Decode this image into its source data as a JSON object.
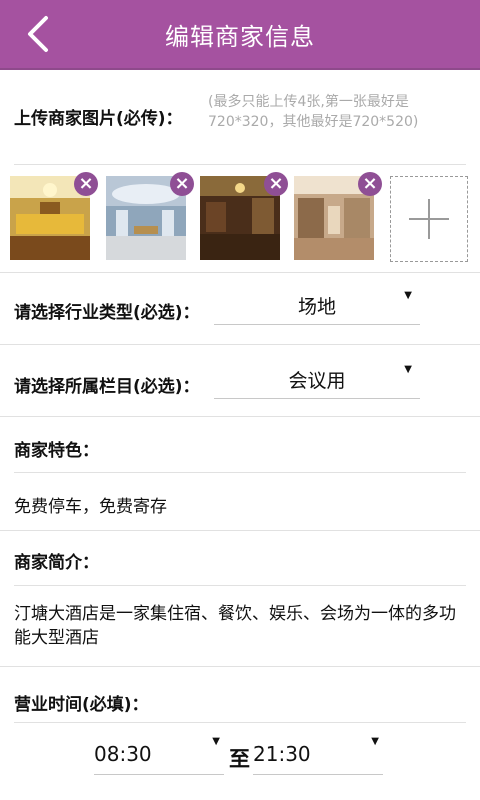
{
  "header": {
    "title": "编辑商家信息"
  },
  "upload": {
    "label": "上传商家图片(必传)：",
    "hint": "(最多只能上传4张,第一张最好是720*320，其他最好是720*520)",
    "images": [
      {
        "name": "hotel-lobby-1"
      },
      {
        "name": "hotel-lobby-2"
      },
      {
        "name": "hotel-lobby-3"
      },
      {
        "name": "hotel-lobby-4"
      }
    ],
    "remove_icon": "close-icon",
    "add_icon": "plus-icon"
  },
  "industry": {
    "label": "请选择行业类型(必选)：",
    "value": "场地"
  },
  "category": {
    "label": "请选择所属栏目(必选)：",
    "value": "会议用"
  },
  "features": {
    "label": "商家特色：",
    "value": "免费停车，免费寄存"
  },
  "intro": {
    "label": "商家简介：",
    "value": "汀塘大酒店是一家集住宿、餐饮、娱乐、会场为一体的多功能大型酒店"
  },
  "hours": {
    "label": "营业时间(必填)：",
    "start": "08:30",
    "to": "至",
    "end": "21:30"
  },
  "colors": {
    "accent": "#a552a0",
    "remove_badge": "#8f4f95"
  }
}
